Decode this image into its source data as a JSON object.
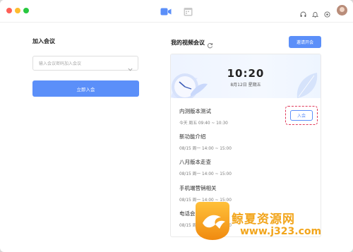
{
  "titlebar": {
    "icons": [
      "video-tab-icon",
      "calendar-tab-icon",
      "headset-icon",
      "bell-icon",
      "settings-icon"
    ],
    "accent": "#5b8ff9"
  },
  "join_section": {
    "title": "加入会议",
    "input_placeholder": "输入会议密码加入会议",
    "join_button": "立即入会"
  },
  "meetings_section": {
    "title": "我的视频会议",
    "schedule_button": "邀请开会",
    "banner": {
      "time": "10:20",
      "date": "8月12日 星期五"
    },
    "join_button": "入会",
    "items": [
      {
        "title": "内测版本测试",
        "time": "今天  周五  09:40 ~ 10:30"
      },
      {
        "title": "新功能介绍",
        "time": "08/15  周一  14:00 ~ 15:00"
      },
      {
        "title": "八月版本走查",
        "time": "08/15  周一  14:00 ~ 15:00"
      },
      {
        "title": "手机端营销相关",
        "time": "08/15  周一  14:00 ~ 15:00"
      },
      {
        "title": "电话会(外部)",
        "time": "08/15  周一  14:00 ~ 15:00"
      }
    ]
  },
  "watermark": {
    "name": "鲸夏资源网",
    "url": "www.j323.com"
  }
}
